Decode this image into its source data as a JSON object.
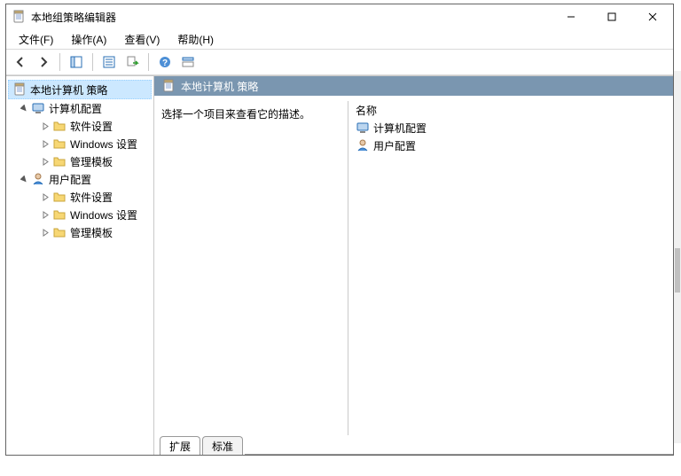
{
  "title": "本地组策略编辑器",
  "menus": {
    "file": "文件(F)",
    "action": "操作(A)",
    "view": "查看(V)",
    "help": "帮助(H)"
  },
  "tree": {
    "root": "本地计算机 策略",
    "computer": "计算机配置",
    "user": "用户配置",
    "software": "软件设置",
    "windows": "Windows 设置",
    "templates": "管理模板"
  },
  "right": {
    "heading": "本地计算机 策略",
    "description_hint": "选择一个项目来查看它的描述。",
    "column_name": "名称",
    "computer_config": "计算机配置",
    "user_config": "用户配置"
  },
  "tabs": {
    "extended": "扩展",
    "standard": "标准"
  }
}
